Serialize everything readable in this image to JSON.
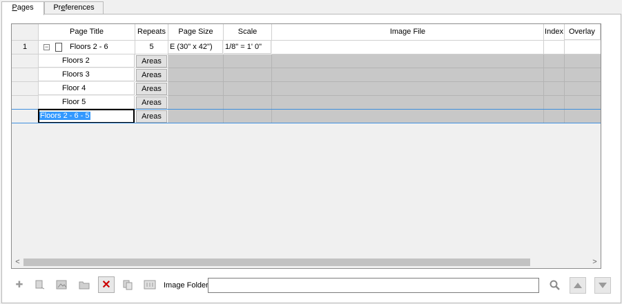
{
  "tabs": [
    {
      "label": "Pages",
      "underline": "P",
      "rest": "ages",
      "active": true
    },
    {
      "label": "Preferences",
      "underline": "e",
      "pre": "Pr",
      "rest": "ferences",
      "active": false
    }
  ],
  "columns": [
    "Page Title",
    "Repeats",
    "Page Size",
    "Scale",
    "Image File",
    "Index",
    "Overlay"
  ],
  "rows": [
    {
      "num": "1",
      "title": "Floors 2 - 6",
      "repeats": "5",
      "page_size": "E (30\" x 42\")",
      "scale": "1/8\" = 1' 0\"",
      "expand_icon": "minus-box-icon",
      "doc_icon": "document-icon"
    },
    {
      "num": "",
      "title": "Floors 2",
      "repeats_button": "Areas"
    },
    {
      "num": "",
      "title": "Floors 3",
      "repeats_button": "Areas"
    },
    {
      "num": "",
      "title": "Floor 4",
      "repeats_button": "Areas"
    },
    {
      "num": "",
      "title": "Floor 5",
      "repeats_button": "Areas"
    },
    {
      "num": "",
      "title": "Floors 2 - 6 - 5",
      "repeats_button": "Areas",
      "editing": true
    }
  ],
  "toolbar": {
    "image_folder_label": "Image Folder",
    "image_folder_value": "",
    "icons": [
      "add-icon",
      "add-page-icon",
      "image-icon",
      "folder-icon",
      "delete-icon",
      "copy-icon",
      "properties-icon",
      "search-icon",
      "move-up-icon",
      "move-down-icon"
    ]
  },
  "scroll": {
    "left_arrow": "<",
    "right_arrow": ">"
  },
  "colors": {
    "selection": "#3399ff",
    "row_line": "#3c8ede",
    "delete": "#cc0000",
    "disabled_cell": "#c8c8c8"
  }
}
